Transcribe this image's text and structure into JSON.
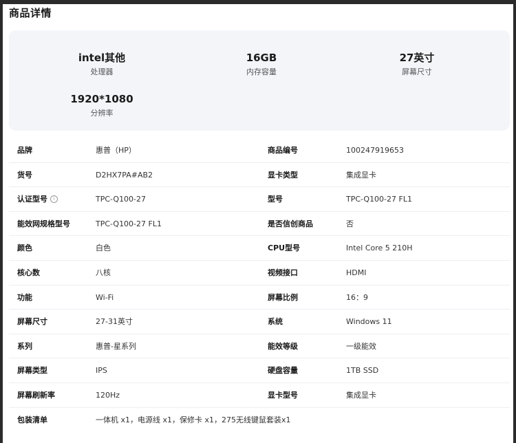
{
  "section_title": "商品详情",
  "summary": [
    {
      "value": "intel其他",
      "label": "处理器"
    },
    {
      "value": "16GB",
      "label": "内存容量"
    },
    {
      "value": "27英寸",
      "label": "屏幕尺寸"
    },
    {
      "value": "1920*1080",
      "label": "分辨率"
    }
  ],
  "specs": [
    {
      "k1": "品牌",
      "v1": "惠普（HP）",
      "k2": "商品编号",
      "v2": "100247919653"
    },
    {
      "k1": "货号",
      "v1": "D2HX7PA#AB2",
      "k2": "显卡类型",
      "v2": "集成显卡"
    },
    {
      "k1": "认证型号",
      "v1": "TPC-Q100-27",
      "k2": "型号",
      "v2": "TPC-Q100-27 FL1",
      "k1_icon": "info-icon"
    },
    {
      "k1": "能效网规格型号",
      "v1": "TPC-Q100-27 FL1",
      "k2": "是否信创商品",
      "v2": "否"
    },
    {
      "k1": "颜色",
      "v1": "白色",
      "k2": "CPU型号",
      "v2": "Intel Core 5 210H"
    },
    {
      "k1": "核心数",
      "v1": "八核",
      "k2": "视频接口",
      "v2": "HDMI"
    },
    {
      "k1": "功能",
      "v1": "Wi-Fi",
      "k2": "屏幕比例",
      "v2": "16：9"
    },
    {
      "k1": "屏幕尺寸",
      "v1": "27-31英寸",
      "k2": "系统",
      "v2": "Windows 11"
    },
    {
      "k1": "系列",
      "v1": "惠普-星系列",
      "k2": "能效等级",
      "v2": "一级能效"
    },
    {
      "k1": "屏幕类型",
      "v1": "IPS",
      "k2": "硬盘容量",
      "v2": "1TB SSD"
    },
    {
      "k1": "屏幕刷新率",
      "v1": "120Hz",
      "k2": "显卡型号",
      "v2": "集成显卡"
    },
    {
      "k1": "包装清单",
      "v1": "一体机 x1，电源线 x1，保修卡 x1，275无线键鼠套装x1"
    }
  ]
}
